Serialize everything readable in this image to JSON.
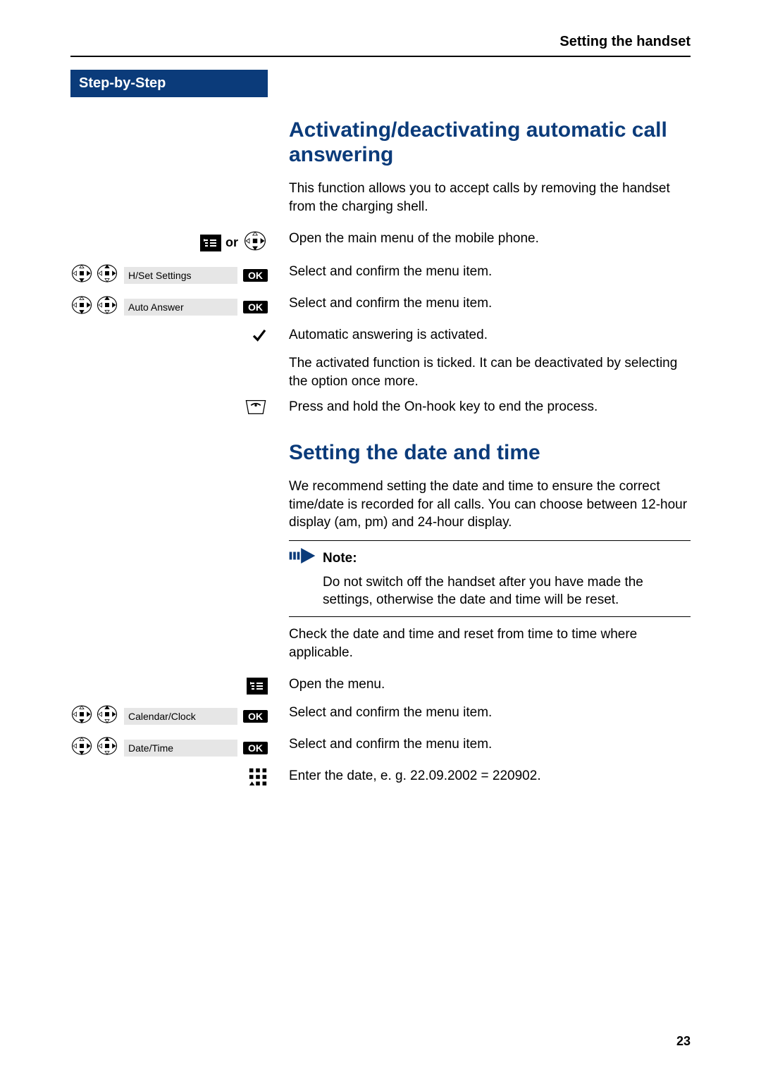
{
  "header": {
    "section_title": "Setting the handset"
  },
  "sidebar": {
    "step_label": "Step-by-Step",
    "or_label": "or"
  },
  "ok_label": "OK",
  "section1": {
    "title": "Activating/deactivating automatic call answering",
    "intro": "This function allows you to accept calls by removing the handset from the charging shell.",
    "steps": [
      {
        "left_menu": null,
        "text": "Open the main menu of the mobile phone."
      },
      {
        "left_menu": "H/Set Settings",
        "text": "Select and confirm the menu item."
      },
      {
        "left_menu": "Auto Answer",
        "text": "Select and confirm the menu item."
      },
      {
        "left_menu": null,
        "text": "Automatic answering is activated."
      },
      {
        "left_menu": null,
        "text": "The activated function is ticked. It can be deactivated by selecting the option once more."
      },
      {
        "left_menu": null,
        "text": "Press and hold the On-hook key to end the process."
      }
    ]
  },
  "section2": {
    "title": "Setting the date and time",
    "intro": "We recommend setting the date and time to ensure the correct time/date is recorded for all calls. You can choose between 12-hour display (am, pm) and 24-hour display.",
    "note_title": "Note:",
    "note_body": "Do not switch off the handset after you have made the settings, otherwise the date and time will be reset.",
    "post_note": "Check the date and time and reset from time to time where applicable.",
    "steps": [
      {
        "left_menu": null,
        "text": "Open the menu."
      },
      {
        "left_menu": "Calendar/Clock",
        "text": "Select and confirm the menu item."
      },
      {
        "left_menu": "Date/Time",
        "text": "Select and confirm the menu item."
      },
      {
        "left_menu": null,
        "text": "Enter the date, e. g. 22.09.2002 = 220902."
      }
    ]
  },
  "page_number": "23"
}
